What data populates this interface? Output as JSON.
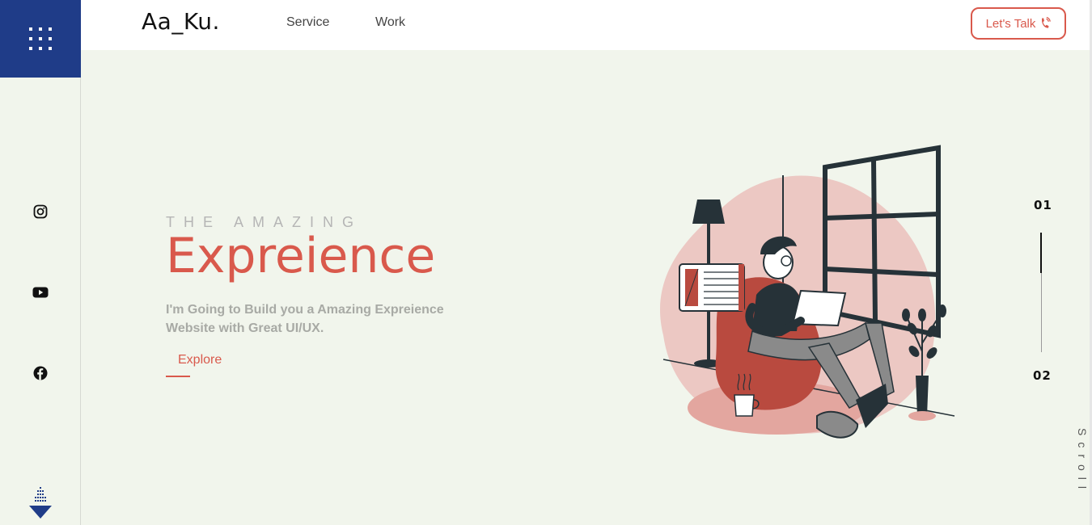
{
  "brand": {
    "logo": "Aa_Ku."
  },
  "nav": {
    "items": [
      {
        "label": "Service"
      },
      {
        "label": "Work"
      }
    ]
  },
  "cta": {
    "label": "Let's Talk",
    "icon": "phone-icon",
    "color": "#d9594c"
  },
  "sidebar": {
    "menu_icon": "grid-menu-icon",
    "menu_color": "#1f3c88",
    "social": [
      {
        "icon": "instagram-icon"
      },
      {
        "icon": "youtube-icon"
      },
      {
        "icon": "facebook-icon"
      }
    ],
    "scroll_icon": "scroll-down-arrow-icon"
  },
  "hero": {
    "eyebrow": "THE AMAZING",
    "title": "Expreience",
    "subtitle": "I'm Going to Build you a Amazing Expreience Website with Great UI/UX.",
    "explore_label": "Explore",
    "accent": "#d9594c"
  },
  "slider": {
    "current": "01",
    "next": "02",
    "scroll_label": "Scroll"
  }
}
